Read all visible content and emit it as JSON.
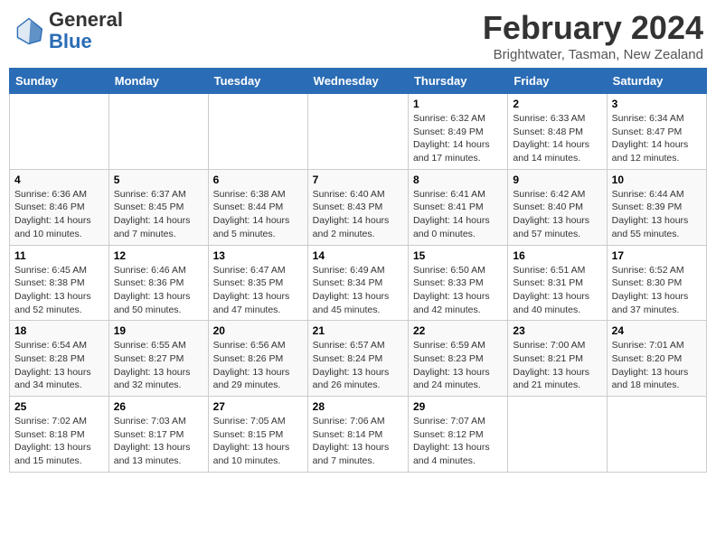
{
  "logo": {
    "line1": "General",
    "line2": "Blue"
  },
  "title": "February 2024",
  "subtitle": "Brightwater, Tasman, New Zealand",
  "headers": [
    "Sunday",
    "Monday",
    "Tuesday",
    "Wednesday",
    "Thursday",
    "Friday",
    "Saturday"
  ],
  "weeks": [
    [
      {
        "day": "",
        "info": ""
      },
      {
        "day": "",
        "info": ""
      },
      {
        "day": "",
        "info": ""
      },
      {
        "day": "",
        "info": ""
      },
      {
        "day": "1",
        "info": "Sunrise: 6:32 AM\nSunset: 8:49 PM\nDaylight: 14 hours and 17 minutes."
      },
      {
        "day": "2",
        "info": "Sunrise: 6:33 AM\nSunset: 8:48 PM\nDaylight: 14 hours and 14 minutes."
      },
      {
        "day": "3",
        "info": "Sunrise: 6:34 AM\nSunset: 8:47 PM\nDaylight: 14 hours and 12 minutes."
      }
    ],
    [
      {
        "day": "4",
        "info": "Sunrise: 6:36 AM\nSunset: 8:46 PM\nDaylight: 14 hours and 10 minutes."
      },
      {
        "day": "5",
        "info": "Sunrise: 6:37 AM\nSunset: 8:45 PM\nDaylight: 14 hours and 7 minutes."
      },
      {
        "day": "6",
        "info": "Sunrise: 6:38 AM\nSunset: 8:44 PM\nDaylight: 14 hours and 5 minutes."
      },
      {
        "day": "7",
        "info": "Sunrise: 6:40 AM\nSunset: 8:43 PM\nDaylight: 14 hours and 2 minutes."
      },
      {
        "day": "8",
        "info": "Sunrise: 6:41 AM\nSunset: 8:41 PM\nDaylight: 14 hours and 0 minutes."
      },
      {
        "day": "9",
        "info": "Sunrise: 6:42 AM\nSunset: 8:40 PM\nDaylight: 13 hours and 57 minutes."
      },
      {
        "day": "10",
        "info": "Sunrise: 6:44 AM\nSunset: 8:39 PM\nDaylight: 13 hours and 55 minutes."
      }
    ],
    [
      {
        "day": "11",
        "info": "Sunrise: 6:45 AM\nSunset: 8:38 PM\nDaylight: 13 hours and 52 minutes."
      },
      {
        "day": "12",
        "info": "Sunrise: 6:46 AM\nSunset: 8:36 PM\nDaylight: 13 hours and 50 minutes."
      },
      {
        "day": "13",
        "info": "Sunrise: 6:47 AM\nSunset: 8:35 PM\nDaylight: 13 hours and 47 minutes."
      },
      {
        "day": "14",
        "info": "Sunrise: 6:49 AM\nSunset: 8:34 PM\nDaylight: 13 hours and 45 minutes."
      },
      {
        "day": "15",
        "info": "Sunrise: 6:50 AM\nSunset: 8:33 PM\nDaylight: 13 hours and 42 minutes."
      },
      {
        "day": "16",
        "info": "Sunrise: 6:51 AM\nSunset: 8:31 PM\nDaylight: 13 hours and 40 minutes."
      },
      {
        "day": "17",
        "info": "Sunrise: 6:52 AM\nSunset: 8:30 PM\nDaylight: 13 hours and 37 minutes."
      }
    ],
    [
      {
        "day": "18",
        "info": "Sunrise: 6:54 AM\nSunset: 8:28 PM\nDaylight: 13 hours and 34 minutes."
      },
      {
        "day": "19",
        "info": "Sunrise: 6:55 AM\nSunset: 8:27 PM\nDaylight: 13 hours and 32 minutes."
      },
      {
        "day": "20",
        "info": "Sunrise: 6:56 AM\nSunset: 8:26 PM\nDaylight: 13 hours and 29 minutes."
      },
      {
        "day": "21",
        "info": "Sunrise: 6:57 AM\nSunset: 8:24 PM\nDaylight: 13 hours and 26 minutes."
      },
      {
        "day": "22",
        "info": "Sunrise: 6:59 AM\nSunset: 8:23 PM\nDaylight: 13 hours and 24 minutes."
      },
      {
        "day": "23",
        "info": "Sunrise: 7:00 AM\nSunset: 8:21 PM\nDaylight: 13 hours and 21 minutes."
      },
      {
        "day": "24",
        "info": "Sunrise: 7:01 AM\nSunset: 8:20 PM\nDaylight: 13 hours and 18 minutes."
      }
    ],
    [
      {
        "day": "25",
        "info": "Sunrise: 7:02 AM\nSunset: 8:18 PM\nDaylight: 13 hours and 15 minutes."
      },
      {
        "day": "26",
        "info": "Sunrise: 7:03 AM\nSunset: 8:17 PM\nDaylight: 13 hours and 13 minutes."
      },
      {
        "day": "27",
        "info": "Sunrise: 7:05 AM\nSunset: 8:15 PM\nDaylight: 13 hours and 10 minutes."
      },
      {
        "day": "28",
        "info": "Sunrise: 7:06 AM\nSunset: 8:14 PM\nDaylight: 13 hours and 7 minutes."
      },
      {
        "day": "29",
        "info": "Sunrise: 7:07 AM\nSunset: 8:12 PM\nDaylight: 13 hours and 4 minutes."
      },
      {
        "day": "",
        "info": ""
      },
      {
        "day": "",
        "info": ""
      }
    ]
  ]
}
